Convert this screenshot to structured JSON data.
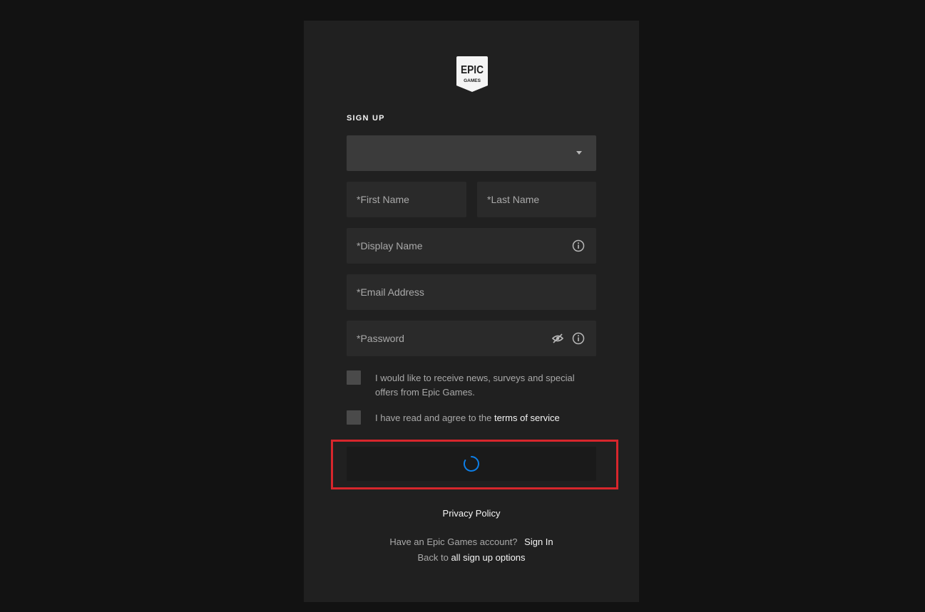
{
  "logo": {
    "line1": "EPIC",
    "line2": "GAMES"
  },
  "form": {
    "heading": "SIGN UP",
    "country_select": {
      "value": ""
    },
    "first_name": {
      "placeholder": "*First Name"
    },
    "last_name": {
      "placeholder": "*Last Name"
    },
    "display_name": {
      "placeholder": "*Display Name"
    },
    "email": {
      "placeholder": "*Email Address"
    },
    "password": {
      "placeholder": "*Password"
    },
    "newsletter_checkbox": {
      "label": "I would like to receive news, surveys and special offers from Epic Games.",
      "checked": false
    },
    "tos_checkbox": {
      "label_prefix": "I have read and agree to the",
      "link_text": "terms of service",
      "checked": false
    },
    "submit": {
      "state": "loading"
    }
  },
  "footer": {
    "privacy_policy": "Privacy Policy",
    "have_account": "Have an Epic Games account?",
    "sign_in": "Sign In",
    "back_to": "Back to",
    "all_signup_options": "all sign up options"
  },
  "colors": {
    "page_bg": "#121212",
    "card_bg": "#202020",
    "input_bg": "#2a2a2a",
    "select_bg": "#3b3b3b",
    "spinner": "#0d7fe8",
    "highlight": "#d7262c"
  }
}
